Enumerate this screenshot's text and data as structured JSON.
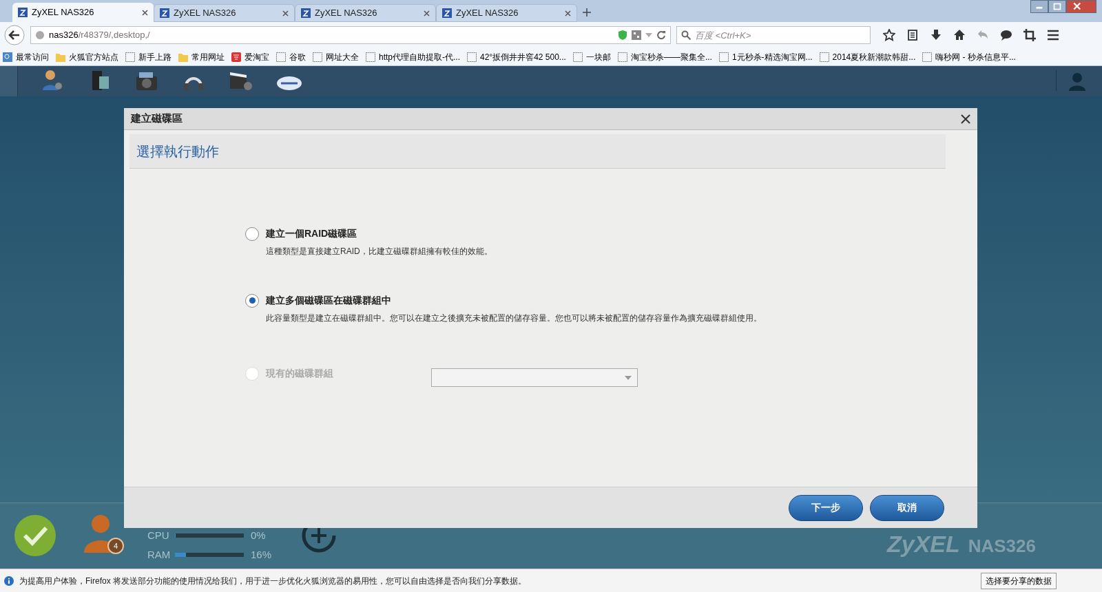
{
  "browser": {
    "tabs": [
      {
        "title": "ZyXEL NAS326",
        "selected": true
      },
      {
        "title": "ZyXEL NAS326",
        "selected": false
      },
      {
        "title": "ZyXEL NAS326",
        "selected": false
      },
      {
        "title": "ZyXEL NAS326",
        "selected": false
      }
    ],
    "url": {
      "host": "nas326",
      "path": "/r48379/,desktop,/"
    },
    "search_placeholder": "百度 <Ctrl+K>",
    "bookmarks": [
      {
        "label": "最常访问",
        "kind": "blue"
      },
      {
        "label": "火狐官方站点",
        "kind": "folder"
      },
      {
        "label": "新手上路",
        "kind": "blank"
      },
      {
        "label": "常用网址",
        "kind": "folder"
      },
      {
        "label": "爱淘宝",
        "kind": "red"
      },
      {
        "label": "谷歌",
        "kind": "blank"
      },
      {
        "label": "网址大全",
        "kind": "blank"
      },
      {
        "label": "http代理自助提取-代...",
        "kind": "blank"
      },
      {
        "label": "42°扳倒井井窖42 500...",
        "kind": "blank"
      },
      {
        "label": "一块邮",
        "kind": "blank"
      },
      {
        "label": "淘宝秒杀——聚集全...",
        "kind": "blank"
      },
      {
        "label": "1元秒杀-精选淘宝网...",
        "kind": "blank"
      },
      {
        "label": "2014夏秋新潮款韩甜...",
        "kind": "blank"
      },
      {
        "label": "嗨秒网 - 秒杀信息平...",
        "kind": "blank"
      }
    ],
    "notification": "为提高用户体验，Firefox 将发送部分功能的使用情况给我们，用于进一步优化火狐浏览器的易用性，您可以自由选择是否向我们分享数据。",
    "notification_button": "选择要分享的数据"
  },
  "dashboard": {
    "user_badge": "4",
    "meters": [
      {
        "label": "CPU",
        "level": 0.0,
        "reading": "0%"
      },
      {
        "label": "RAM",
        "level": 0.16,
        "reading": "16%"
      }
    ],
    "brand": "ZyXEL",
    "model": "NAS326"
  },
  "dialog": {
    "title": "建立磁碟區",
    "heading": "選擇執行動作",
    "options": [
      {
        "label": "建立一個RAID磁碟區",
        "description": "這種類型是直接建立RAID，比建立磁碟群組擁有較佳的效能。",
        "selected": false,
        "disabled": false,
        "kind": "plain"
      },
      {
        "label": "建立多個磁碟區在磁碟群組中",
        "description": "此容量類型是建立在磁碟群組中。您可以在建立之後擴充未被配置的儲存容量。您也可以將未被配置的儲存容量作為擴充磁碟群組使用。",
        "selected": true,
        "disabled": false,
        "kind": "plain"
      },
      {
        "label": "現有的磁碟群組",
        "selected": false,
        "disabled": true,
        "kind": "dropdown"
      }
    ],
    "buttons": [
      "下一步",
      "取消"
    ]
  }
}
